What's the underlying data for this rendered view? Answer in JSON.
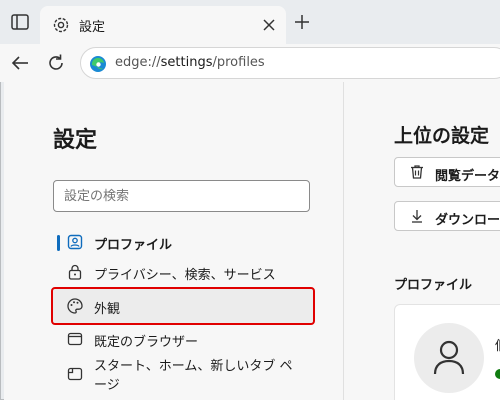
{
  "tab": {
    "title": "設定"
  },
  "address": {
    "scheme": "edge://",
    "host": "settings",
    "path": "/profiles"
  },
  "sidebar": {
    "title": "設定",
    "search_placeholder": "設定の検索",
    "items": [
      {
        "label": "プロファイル",
        "icon": "profile-icon",
        "active": true
      },
      {
        "label": "プライバシー、検索、サービス",
        "icon": "lock-icon"
      },
      {
        "label": "外観",
        "icon": "palette-icon",
        "highlighted": true
      },
      {
        "label": "既定のブラウザー",
        "icon": "browser-window-icon"
      },
      {
        "label": "スタート、ホーム、新しいタブ ページ",
        "line1": "スタート、ホーム、新しいタブ ペ",
        "line2": "ージ",
        "icon": "home-tab-icon"
      }
    ]
  },
  "main": {
    "title": "上位の設定",
    "buttons": [
      {
        "label": "閲覧データ",
        "icon": "trash-icon"
      },
      {
        "label": "ダウンロー",
        "icon": "download-icon"
      }
    ],
    "profile_header": "プロファイル",
    "profile_name": "個"
  },
  "colors": {
    "accent": "#0f6cbd",
    "highlight_box": "#e00000",
    "sync_ok": "#107c10"
  }
}
